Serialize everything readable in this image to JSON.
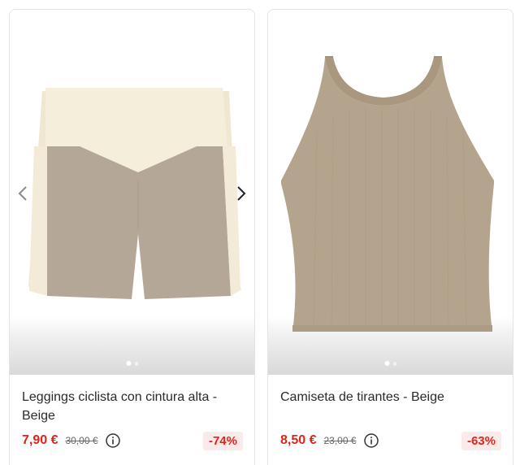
{
  "products": [
    {
      "title": "Leggings ciclista con cintura alta - Beige",
      "price_now": "7,90 €",
      "price_old": "30,00 €",
      "discount": "-74%",
      "image_icon": "bike-shorts-image",
      "colors": {
        "body": "#b5a797",
        "waistband": "#f5eedb"
      },
      "carousel": {
        "dots": 2,
        "active": 1
      }
    },
    {
      "title": "Camiseta de tirantes - Beige",
      "price_now": "8,50 €",
      "price_old": "23,00 €",
      "discount": "-63%",
      "image_icon": "tank-top-image",
      "colors": {
        "body": "#b5a48d"
      },
      "carousel": {
        "dots": 2,
        "active": 1
      }
    }
  ],
  "icons": {
    "prev": "chevron-left-icon",
    "next": "chevron-right-icon",
    "info": "info-icon"
  },
  "colors": {
    "sale_price": "#e2231a",
    "discount_bg": "#fbeaea",
    "card_border": "#e3e3e3"
  }
}
